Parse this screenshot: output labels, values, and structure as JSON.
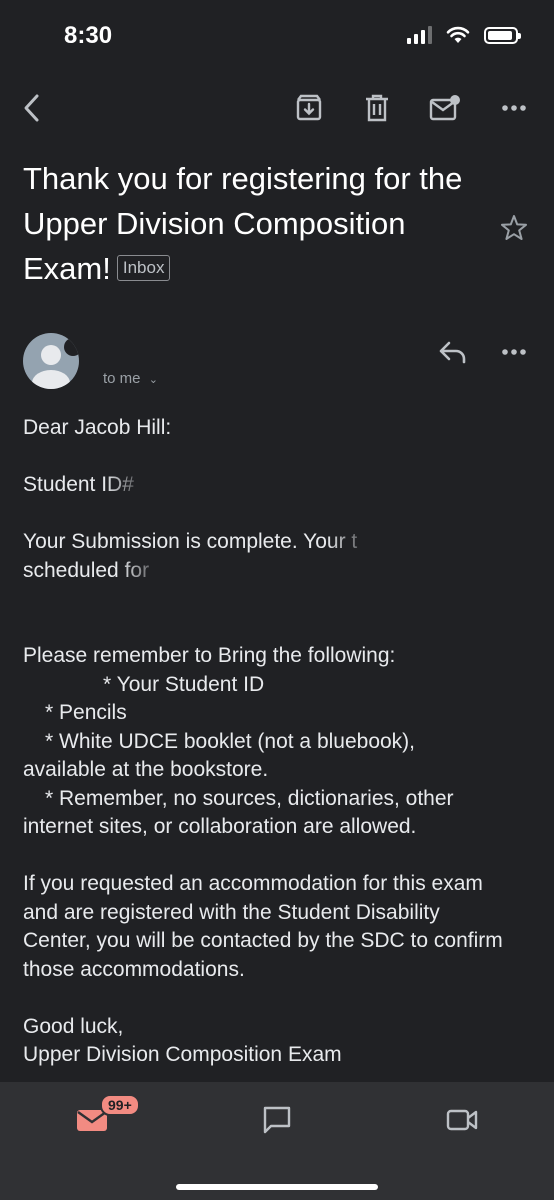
{
  "status_bar": {
    "time": "8:30"
  },
  "email": {
    "subject": "Thank you for registering for the Upper Division Composition Exam!",
    "label": "Inbox",
    "recipient": "to me",
    "greeting": "Dear Jacob Hill:",
    "student_id": "Student ID#",
    "submission_line1": "Your Submission is complete. Your t",
    "submission_line2": "scheduled for",
    "reminder_intro": "Please remember to Bring the following:",
    "item1": "*  Your Student ID",
    "item2": "*  Pencils",
    "item3": "*  White UDCE booklet (not a bluebook),",
    "item3_cont": "available at the bookstore.",
    "item4": "*  Remember, no sources, dictionaries, other",
    "item4_cont": "internet sites, or collaboration are allowed.",
    "accommodation": "If you requested an accommodation for this exam and are registered with the Student Disability Center, you will be contacted by the SDC to confirm those accommodations.",
    "signoff": "Good luck,",
    "signature": "Upper Division Composition Exam"
  },
  "bottom_nav": {
    "mail_badge": "99+"
  },
  "colors": {
    "background": "#202124",
    "nav_bg": "#303134",
    "accent": "#f28b82"
  }
}
